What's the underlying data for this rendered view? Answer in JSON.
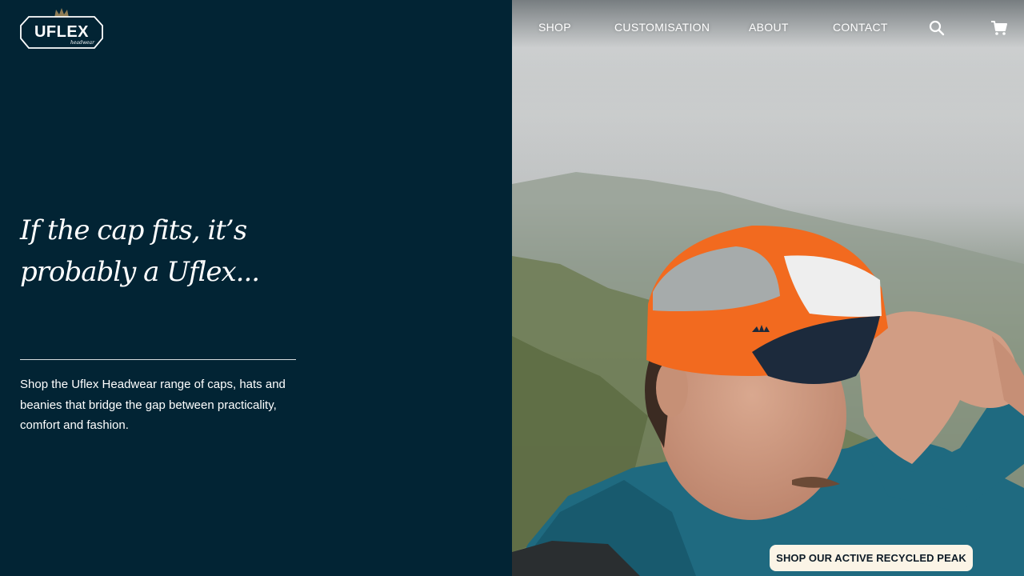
{
  "brand": {
    "name": "UFLEX",
    "tagline": "headwear"
  },
  "nav": {
    "links": [
      "SHOP",
      "CUSTOMISATION",
      "ABOUT",
      "CONTACT"
    ],
    "icons": [
      "search-icon",
      "cart-icon"
    ]
  },
  "hero": {
    "headline_line1": "If the cap fits, it’s",
    "headline_line2": "probably a Uflex...",
    "intro": "Shop the Uflex Headwear range of caps, hats and beanies that bridge the gap between practicality, comfort and fashion.",
    "cta_label": "SHOP OUR ACTIVE RECYCLED PEAK"
  },
  "colors": {
    "panel_background": "#022434",
    "cap_orange": "#f26a1f",
    "cta_background": "#fbf4e6"
  }
}
